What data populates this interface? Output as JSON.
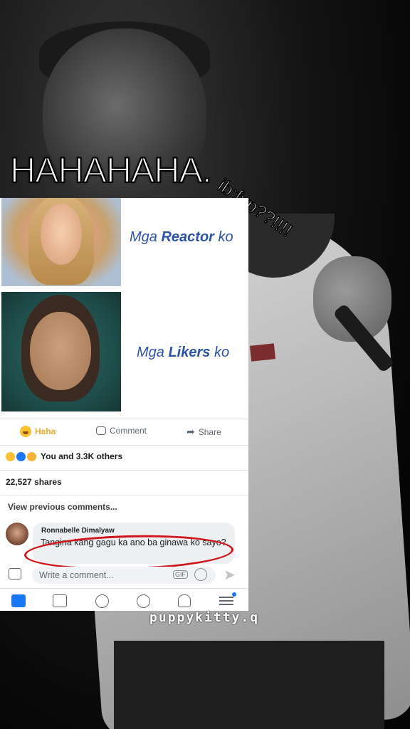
{
  "overlay": {
    "main_caption": "HAHAHAHA.",
    "side_caption": "ib:fyp??!!!!",
    "watermark": "puppykitty.q"
  },
  "post": {
    "meme_labels": {
      "top": {
        "prefix": "Mga ",
        "bold": "Reactor",
        "suffix": " ko"
      },
      "bottom": {
        "prefix": "Mga ",
        "bold": "Likers",
        "suffix": " ko"
      }
    },
    "actions": {
      "haha_label": "Haha",
      "comment_label": "Comment",
      "share_label": "Share"
    },
    "reactions_text": "You and 3.3K others",
    "shares_text": "22,527 shares",
    "view_previous": "View previous comments...",
    "comment": {
      "author": "Ronnabelle Dimalyaw",
      "text": "Tangina kang gagu ka ano ba ginawa ko sayo?"
    },
    "composer": {
      "placeholder": "Write a comment...",
      "gif_label": "GIF"
    }
  },
  "colors": {
    "brand": "#1877f2",
    "haha": "#f0a928",
    "highlight_ring": "#d0141b",
    "meme_label": "#2b54a8"
  },
  "icons": [
    "haha-emoji-icon",
    "comment-icon",
    "share-icon",
    "camera-icon",
    "gif-icon",
    "sticker-icon",
    "send-icon",
    "news-feed-icon",
    "watch-icon",
    "profile-icon",
    "groups-icon",
    "notifications-icon",
    "menu-icon"
  ]
}
